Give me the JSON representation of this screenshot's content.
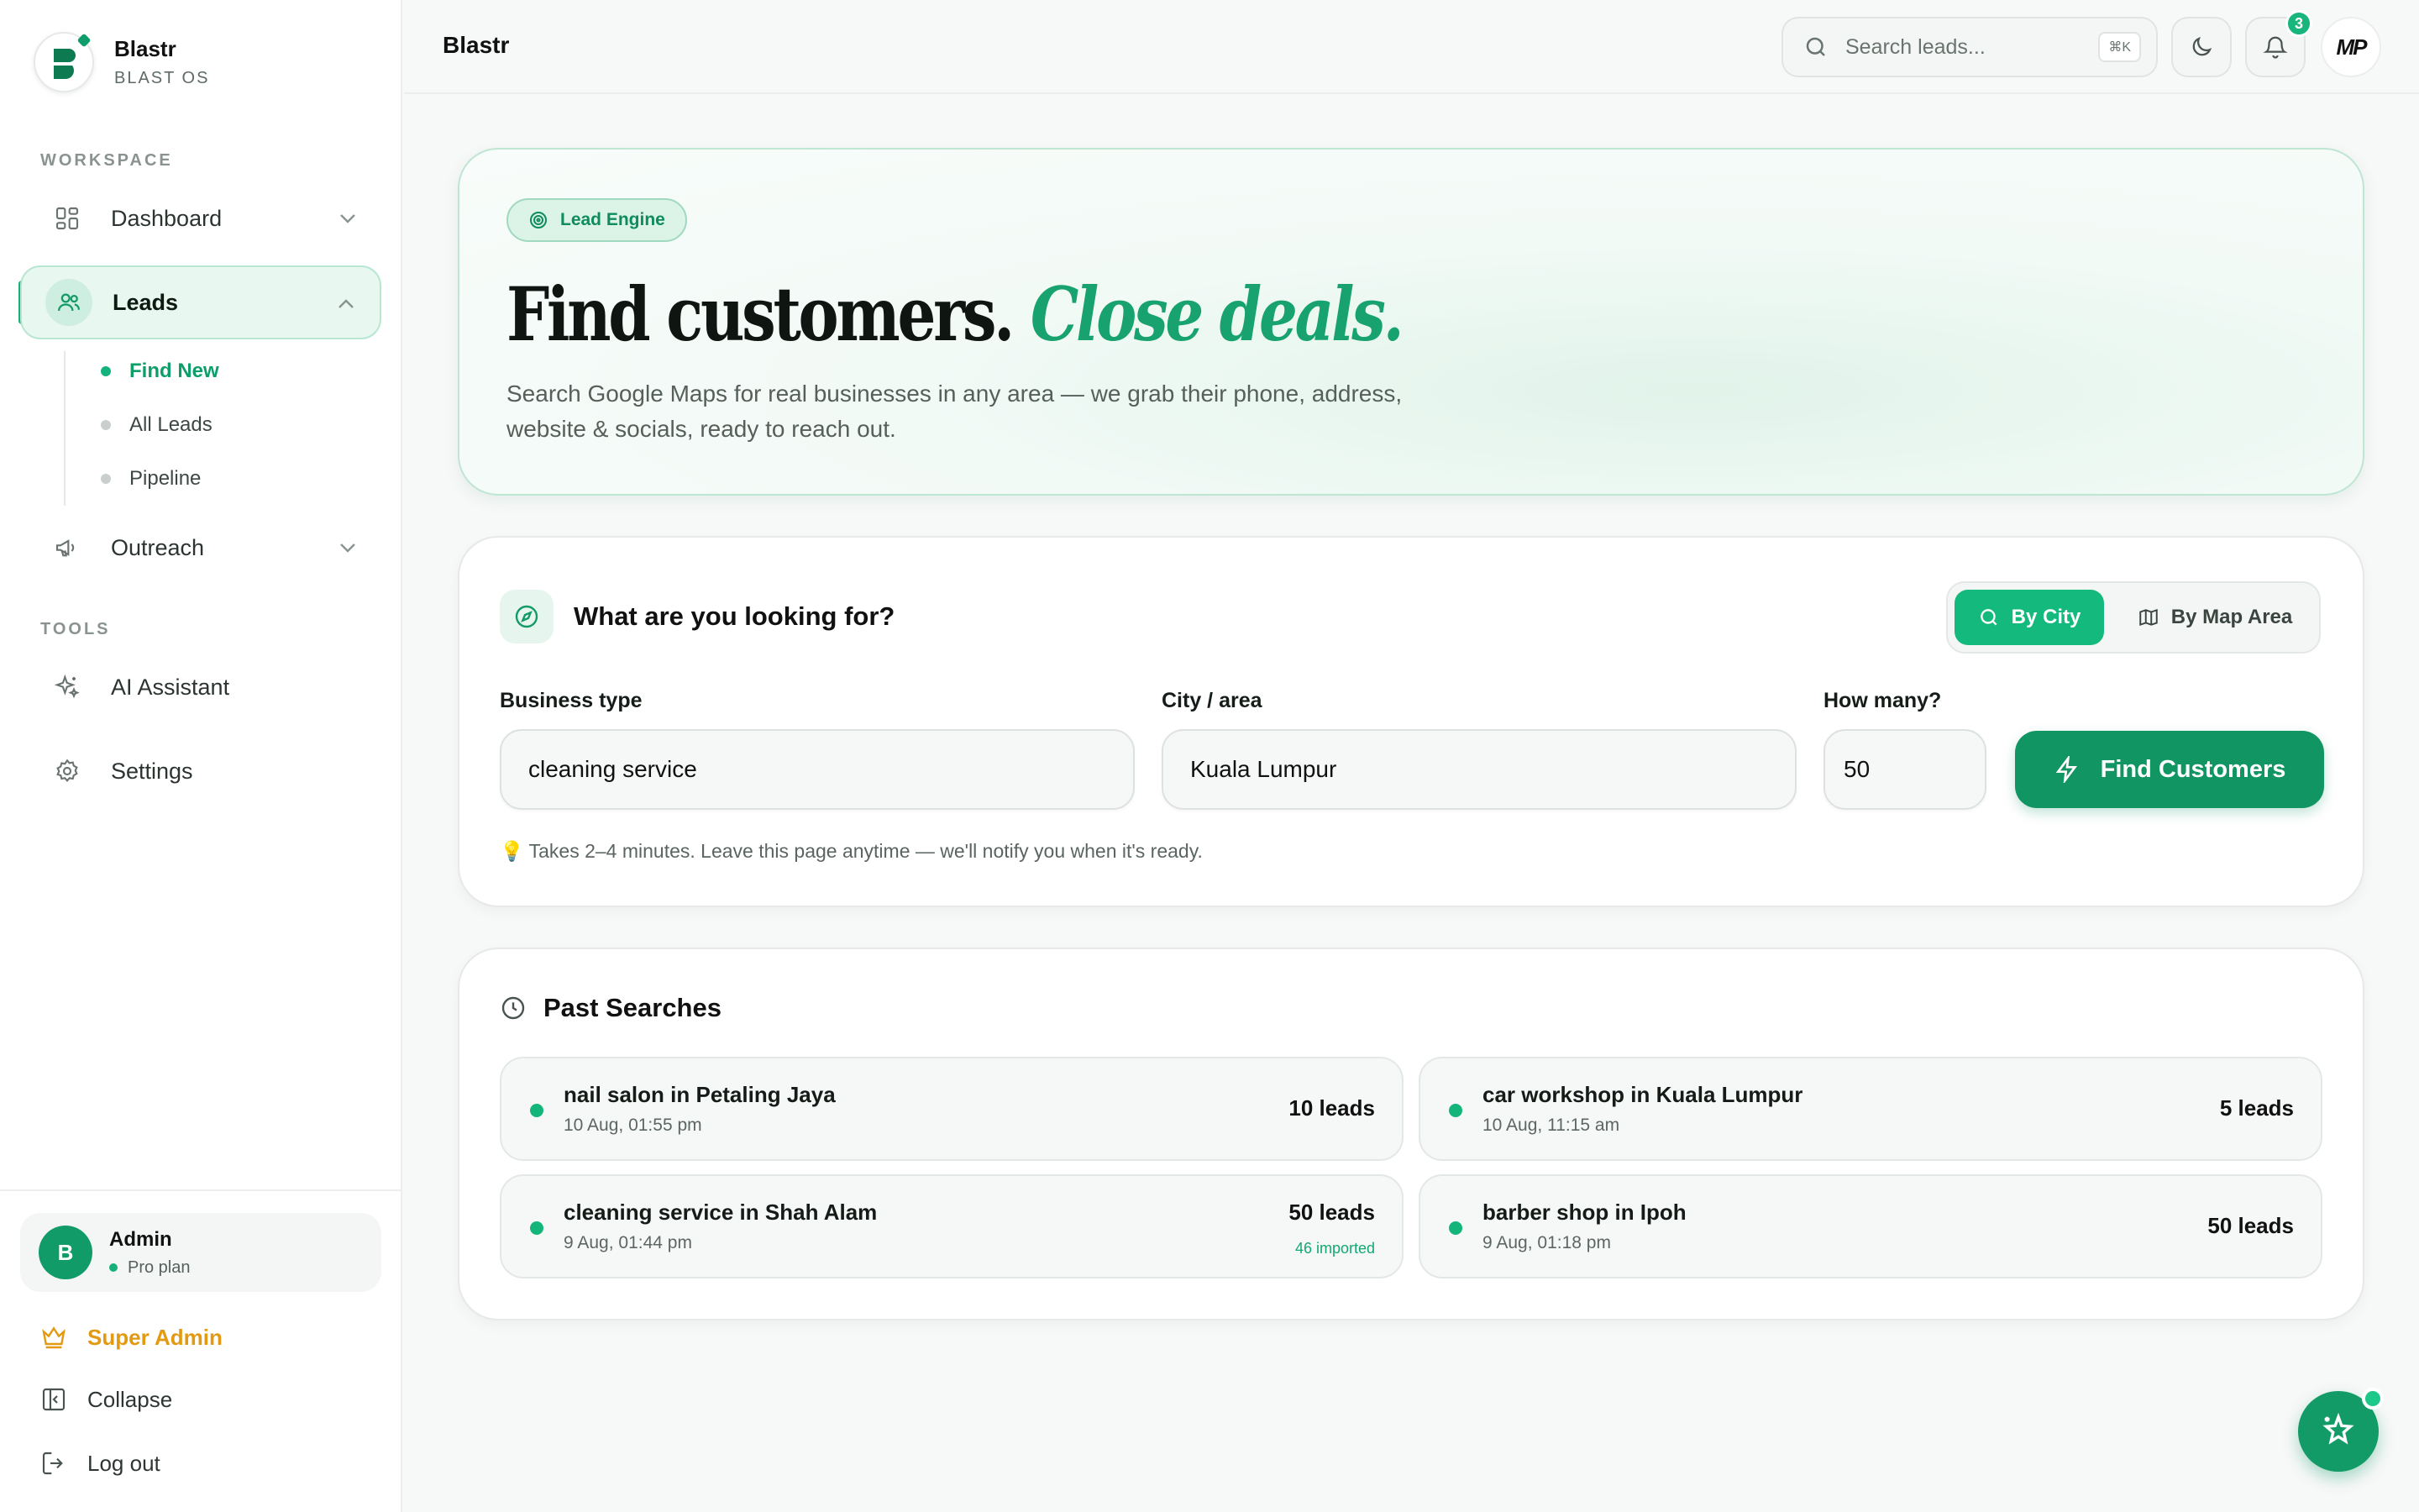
{
  "brand": {
    "name": "Blastr",
    "sub": "BLAST OS"
  },
  "sidebar": {
    "workspace_label": "WORKSPACE",
    "tools_label": "TOOLS",
    "items": [
      {
        "label": "Dashboard",
        "icon": "grid-icon"
      },
      {
        "label": "Leads",
        "icon": "users-icon"
      },
      {
        "label": "Outreach",
        "icon": "megaphone-icon"
      },
      {
        "label": "AI Assistant",
        "icon": "sparkles-icon"
      },
      {
        "label": "Settings",
        "icon": "gear-icon"
      }
    ],
    "leads_sub": [
      "Find New",
      "All Leads",
      "Pipeline"
    ]
  },
  "user": {
    "initial": "B",
    "name": "Admin",
    "plan": "Pro plan"
  },
  "bottom_links": {
    "super_admin": "Super Admin",
    "collapse": "Collapse",
    "logout": "Log out"
  },
  "topbar": {
    "title": "Blastr",
    "search_placeholder": "Search leads...",
    "shortcut": "⌘K",
    "notifications": "3",
    "profile": "MP"
  },
  "hero": {
    "pill": "Lead Engine",
    "title_main": "Find customers.",
    "title_accent": "Close deals.",
    "description": "Search Google Maps for real businesses in any area — we grab their phone, address, website & socials, ready to reach out."
  },
  "search": {
    "heading": "What are you looking for?",
    "mode_city": "By City",
    "mode_map": "By Map Area",
    "business_label": "Business type",
    "business_value": "cleaning service",
    "city_label": "City / area",
    "city_value": "Kuala Lumpur",
    "count_label": "How many?",
    "count_value": "50",
    "submit": "Find Customers",
    "hint": "💡 Takes 2–4 minutes. Leave this page anytime — we'll notify you when it's ready."
  },
  "past": {
    "heading": "Past Searches",
    "items": [
      {
        "query": "nail salon in Petaling Jaya",
        "time": "10 Aug, 01:55 pm",
        "count": "10 leads",
        "imported": ""
      },
      {
        "query": "car workshop in Kuala Lumpur",
        "time": "10 Aug, 11:15 am",
        "count": "5 leads",
        "imported": ""
      },
      {
        "query": "cleaning service in Shah Alam",
        "time": "9 Aug, 01:44 pm",
        "count": "50 leads",
        "imported": "46 imported"
      },
      {
        "query": "barber shop in Ipoh",
        "time": "9 Aug, 01:18 pm",
        "count": "50 leads",
        "imported": ""
      }
    ]
  },
  "colors": {
    "accent": "#14b97e",
    "accent_dark": "#119562",
    "gold": "#e39a12"
  }
}
